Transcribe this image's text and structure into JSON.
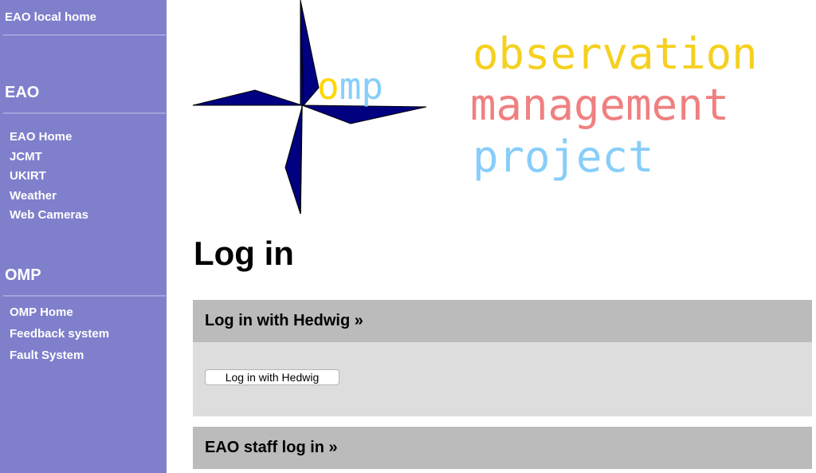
{
  "sidebar": {
    "local_home": "EAO local home",
    "sections": [
      {
        "title": "EAO",
        "items": [
          "EAO Home",
          "JCMT",
          "UKIRT",
          "Weather",
          "Web Cameras"
        ]
      },
      {
        "title": "OMP",
        "items": [
          "OMP Home",
          "Feedback system",
          "Fault System"
        ]
      }
    ]
  },
  "logo": {
    "mark_text": "omp",
    "line1": "observation",
    "line2": "management",
    "line3": "project",
    "colors": {
      "star": "#000080",
      "omp_o": "#ffd700",
      "omp_mp": "#87cefa",
      "line1": "#f5d020",
      "line2": "#f08080",
      "line3": "#87cefa"
    }
  },
  "main": {
    "title": "Log in",
    "hedwig_header": "Log in with Hedwig »",
    "hedwig_button": "Log in with Hedwig",
    "staff_header": "EAO staff log in »"
  },
  "colors": {
    "sidebar_bg": "#7f7fcc",
    "panel_header_bg": "#bbbbbb",
    "panel_body_bg": "#dddddd"
  }
}
